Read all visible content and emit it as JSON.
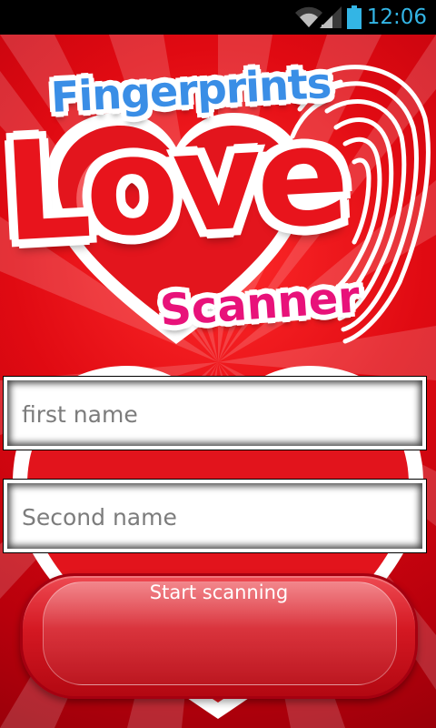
{
  "status_bar": {
    "time": "12:06",
    "icons": [
      "wifi-icon",
      "signal-icon",
      "battery-icon"
    ],
    "accent_color": "#33b5e5"
  },
  "logo": {
    "line1": "Fingerprints",
    "line2": "Love",
    "line3": "Scanner",
    "colors": {
      "line1": "#3a8ee6",
      "line2": "#e8141c",
      "line3": "#e8127a"
    }
  },
  "form": {
    "first_name_placeholder": "first name",
    "first_name_value": "",
    "second_name_placeholder": "Second name",
    "second_name_value": ""
  },
  "button": {
    "start_label": "Start scanning"
  },
  "colors": {
    "background": "#e00a12",
    "button": "#d41822"
  }
}
